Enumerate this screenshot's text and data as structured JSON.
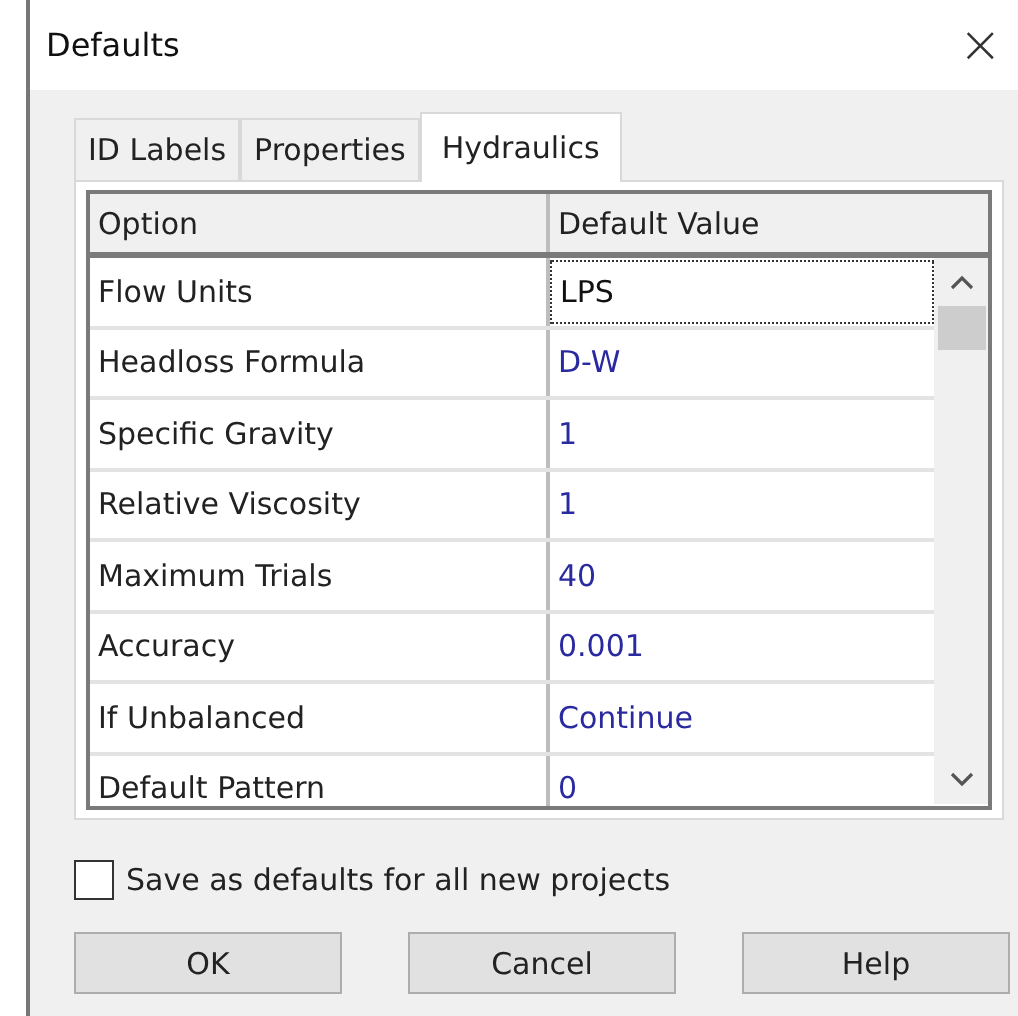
{
  "window": {
    "title": "Defaults",
    "close": "×"
  },
  "tabs": [
    {
      "label": "ID Labels",
      "selected": false
    },
    {
      "label": "Properties",
      "selected": false
    },
    {
      "label": "Hydraulics",
      "selected": true
    }
  ],
  "grid": {
    "columns": [
      "Option",
      "Default Value"
    ],
    "rows": [
      {
        "option": "Flow Units",
        "value": "LPS",
        "focused": true
      },
      {
        "option": "Headloss Formula",
        "value": "D-W",
        "focused": false
      },
      {
        "option": "Specific Gravity",
        "value": "1",
        "focused": false
      },
      {
        "option": "Relative Viscosity",
        "value": "1",
        "focused": false
      },
      {
        "option": "Maximum Trials",
        "value": "40",
        "focused": false
      },
      {
        "option": "Accuracy",
        "value": "0.001",
        "focused": false
      },
      {
        "option": "If Unbalanced",
        "value": "Continue",
        "focused": false
      },
      {
        "option": "Default Pattern",
        "value": "0",
        "focused": false
      }
    ]
  },
  "save_defaults": {
    "label": "Save as defaults for all new projects",
    "checked": false
  },
  "buttons": [
    "OK",
    "Cancel",
    "Help"
  ]
}
